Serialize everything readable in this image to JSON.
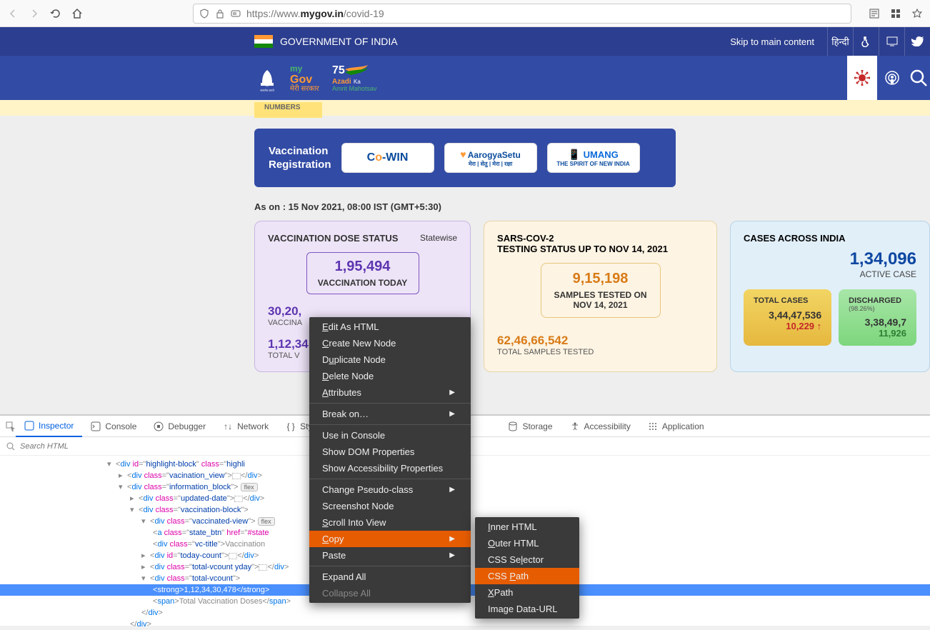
{
  "browser": {
    "url_plain": "https://www.",
    "url_domain": "mygov.in",
    "url_path": "/covid-19",
    "search_placeholder": "Search HTML"
  },
  "govbar": {
    "title": "GOVERNMENT OF INDIA",
    "skip": "Skip to main content",
    "hindi": "हिन्दी"
  },
  "numbers_label": "NUMBERS",
  "vacc_reg": {
    "label1": "Vaccination",
    "label2": "Registration",
    "cowin_c": "C",
    "cowin_o": "o",
    "cowin_rest": "-WIN",
    "aarogya": "AarogyaSetu",
    "aarogya_sub": "मेरा | सेतु | मेरा | रक्षा",
    "umang": "UMANG",
    "umang_sub": "THE SPIRIT OF NEW INDIA"
  },
  "timestamp": "As on : 15 Nov 2021, 08:00 IST (GMT+5:30)",
  "card1": {
    "title": "VACCINATION DOSE STATUS",
    "statewise": "Statewise",
    "today_num": "1,95,494",
    "today_label": "VACCINATION TODAY",
    "stat1_num": "30,20,",
    "stat1_label": "VACCINA",
    "stat2_num": "1,12,34",
    "stat2_label": "TOTAL V"
  },
  "card2": {
    "line1": "SARS-COV-2",
    "line2": "TESTING STATUS UP TO NOV 14, 2021",
    "samples_num": "9,15,198",
    "samples_label1": "SAMPLES TESTED ON",
    "samples_label2": "NOV 14, 2021",
    "total_num": "62,46,66,542",
    "total_label": "TOTAL SAMPLES TESTED"
  },
  "card3": {
    "title": "CASES ACROSS INDIA",
    "big_num": "1,34,096",
    "big_label": "ACTIVE CASE",
    "total_title": "TOTAL CASES",
    "total_num": "3,44,47,536",
    "total_delta": "10,229 ↑",
    "disch_title": "DISCHARGED",
    "disch_pct": "(98.26%)",
    "disch_num": "3,38,49,7",
    "disch_delta": "11,926"
  },
  "devtools": {
    "tabs": [
      "Inspector",
      "Console",
      "Debugger",
      "Network",
      "Sty",
      "Storage",
      "Accessibility",
      "Application"
    ],
    "html_lines": {
      "l1_id": "highlight-block",
      "l1_class": "highli",
      "l2_class": "vacination_view",
      "l3_class": "information_block",
      "l4_class": "updated-date",
      "l5_class": "vaccination-block",
      "l6_class": "vaccinated-view",
      "l7_class": "state_btn",
      "l7_href": "#state",
      "l8_class": "vc-title",
      "l8_text": "Vaccination",
      "l9_id": "today-count",
      "l10_class": "total-vcount yday",
      "l11_class": "total-vcount",
      "l12_text": "1,12,34,30,478",
      "l13_text": "Total Vaccination Doses"
    }
  },
  "ctx1": {
    "items": [
      "Edit As HTML",
      "Create New Node",
      "Duplicate Node",
      "Delete Node",
      "Attributes",
      "Break on…",
      "Use in Console",
      "Show DOM Properties",
      "Show Accessibility Properties",
      "Change Pseudo-class",
      "Screenshot Node",
      "Scroll Into View",
      "Copy",
      "Paste",
      "Expand All",
      "Collapse All"
    ]
  },
  "ctx2": {
    "items": [
      "Inner HTML",
      "Outer HTML",
      "CSS Selector",
      "CSS Path",
      "XPath",
      "Image Data-URL"
    ]
  }
}
